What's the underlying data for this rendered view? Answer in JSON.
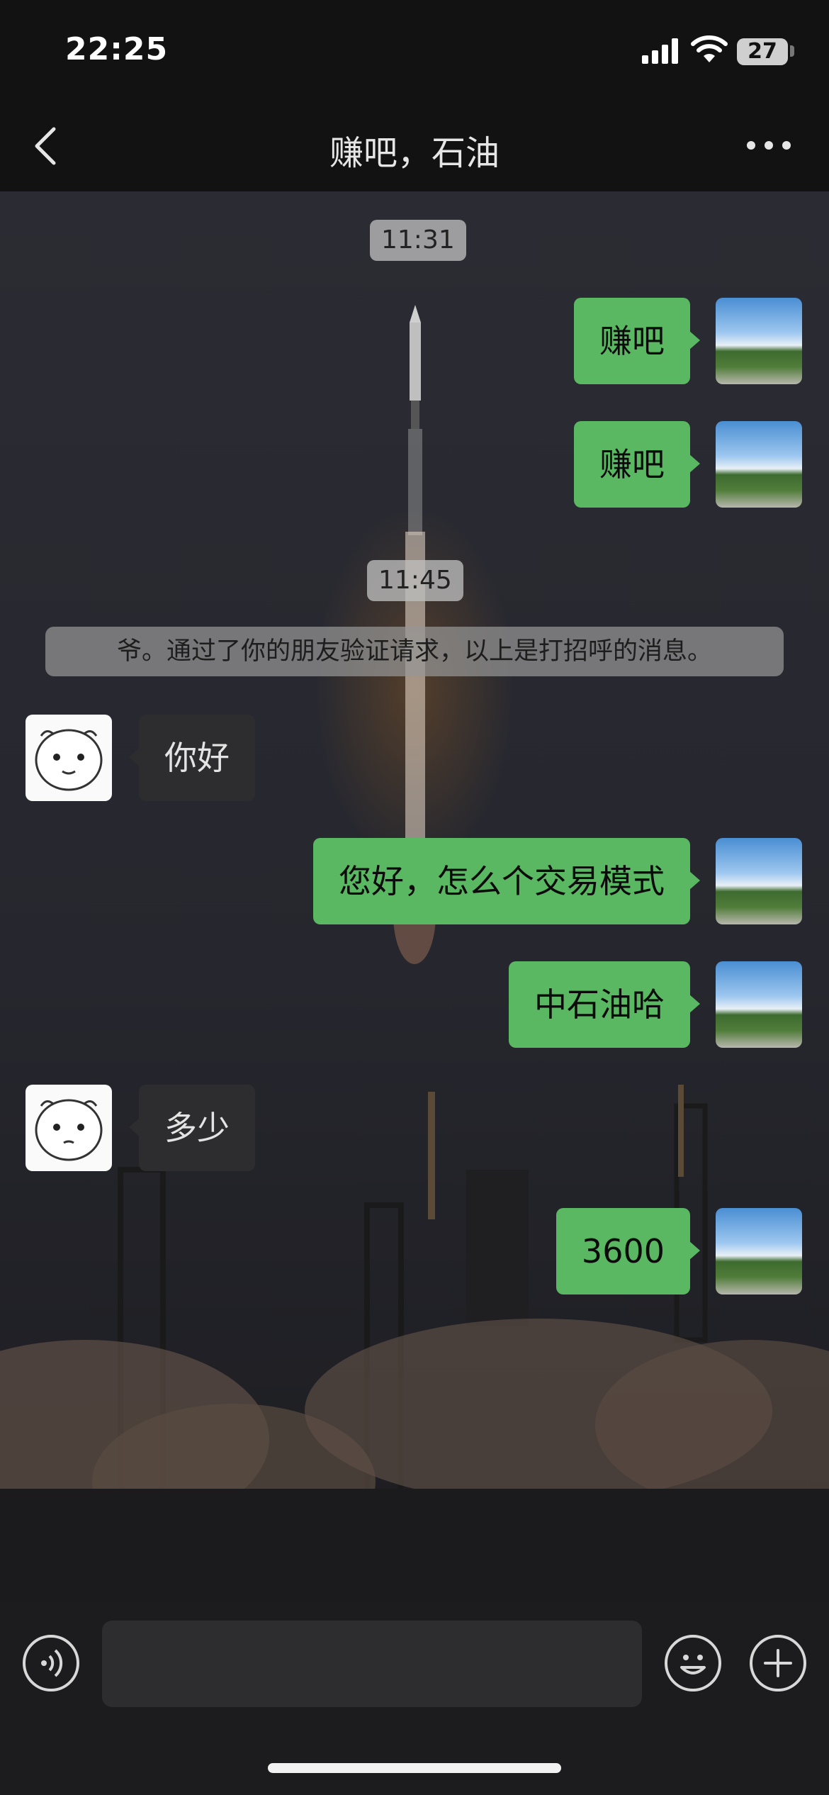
{
  "status_bar": {
    "time": "22:25",
    "battery": "27"
  },
  "nav": {
    "title": "赚吧，石油"
  },
  "messages": [
    {
      "type": "timestamp",
      "text": "11:31"
    },
    {
      "type": "outgoing",
      "text": "赚吧"
    },
    {
      "type": "outgoing",
      "text": "赚吧"
    },
    {
      "type": "timestamp",
      "text": "11:45"
    },
    {
      "type": "system",
      "text": "爷。通过了你的朋友验证请求，以上是打招呼的消息。"
    },
    {
      "type": "incoming",
      "text": "你好"
    },
    {
      "type": "outgoing",
      "text": "您好，怎么个交易模式"
    },
    {
      "type": "outgoing",
      "text": "中石油哈"
    },
    {
      "type": "incoming",
      "text": "多少"
    },
    {
      "type": "outgoing",
      "text": "3600"
    }
  ],
  "input_bar": {
    "value": ""
  }
}
